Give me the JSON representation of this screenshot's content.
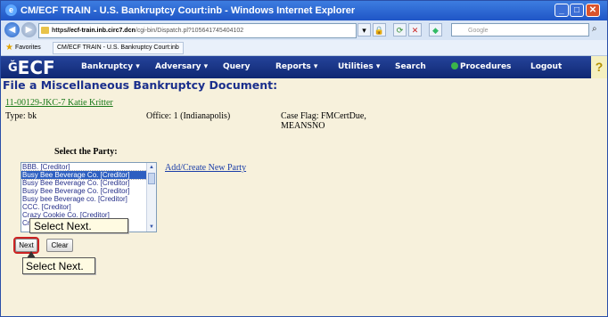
{
  "browser": {
    "title": "CM/ECF TRAIN - U.S. Bankruptcy Court:inb - Windows Internet Explorer",
    "url_scheme": "https",
    "url_host": "//ecf-train.inb.circ7.dcn",
    "url_path": "/cgi-bin/Dispatch.pl?105641745404102",
    "search_placeholder": "Google",
    "favorites_label": "Favorites",
    "favorites_tab": "CM/ECF TRAIN - U.S. Bankruptcy Court:inb"
  },
  "ecf": {
    "logo": "ECF",
    "menu": [
      "Bankruptcy ▾",
      "Adversary ▾",
      "Query",
      "Reports ▾",
      "Utilities ▾",
      "Search",
      "Procedures",
      "Logout"
    ],
    "page_title": "File a Miscellaneous Bankruptcy Document:"
  },
  "case": {
    "link": "11-00129-JKC-7 Katie Kritter",
    "type": "Type: bk",
    "office": "Office: 1 (Indianapolis)",
    "flag_line1": "Case Flag: FMCertDue,",
    "flag_line2": "MEANSNO"
  },
  "party": {
    "heading": "Select the Party:",
    "items": [
      "BBB. [Creditor]",
      "Busy Bee Beverage Co. [Creditor]",
      "Busy Bee Beverage Co. [Creditor]",
      "Busy Bee Beverage Co. [Creditor]",
      "Busy bee Beverage co. [Creditor]",
      "CCC. [Creditor]",
      "Crazy Cookie Co. [Creditor]",
      "Crazy Cookie Co. [Creditor]"
    ],
    "selected_index": 1,
    "add_link": "Add/Create New Party"
  },
  "buttons": {
    "next": "Next",
    "clear": "Clear"
  },
  "callouts": {
    "first": "Select Next.",
    "second": "Select Next."
  },
  "colors": {
    "ecf_bar": "#1a3587",
    "content_bg": "#f7f1dc",
    "title_blue": "#1b2f8c"
  }
}
